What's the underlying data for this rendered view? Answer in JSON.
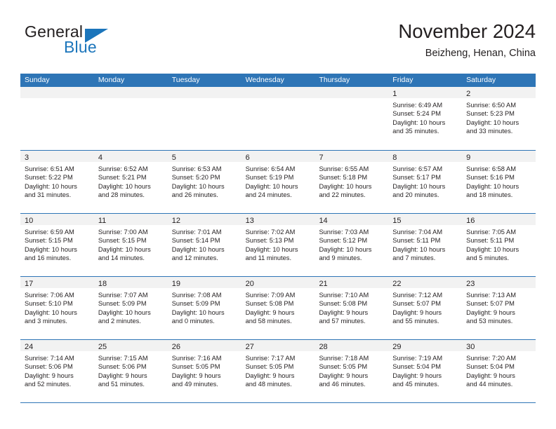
{
  "brand": {
    "name_part1": "General",
    "name_part2": "Blue",
    "accent_color": "#1b75bb"
  },
  "header": {
    "title": "November 2024",
    "location": "Beizheng, Henan, China"
  },
  "calendar": {
    "header_bg": "#2e75b6",
    "day_strip_bg": "#f2f2f2",
    "weekdays": [
      "Sunday",
      "Monday",
      "Tuesday",
      "Wednesday",
      "Thursday",
      "Friday",
      "Saturday"
    ],
    "weeks": [
      [
        {
          "day": "",
          "empty": true
        },
        {
          "day": "",
          "empty": true
        },
        {
          "day": "",
          "empty": true
        },
        {
          "day": "",
          "empty": true
        },
        {
          "day": "",
          "empty": true
        },
        {
          "day": "1",
          "sunrise": "Sunrise: 6:49 AM",
          "sunset": "Sunset: 5:24 PM",
          "daylight1": "Daylight: 10 hours",
          "daylight2": "and 35 minutes."
        },
        {
          "day": "2",
          "sunrise": "Sunrise: 6:50 AM",
          "sunset": "Sunset: 5:23 PM",
          "daylight1": "Daylight: 10 hours",
          "daylight2": "and 33 minutes."
        }
      ],
      [
        {
          "day": "3",
          "sunrise": "Sunrise: 6:51 AM",
          "sunset": "Sunset: 5:22 PM",
          "daylight1": "Daylight: 10 hours",
          "daylight2": "and 31 minutes."
        },
        {
          "day": "4",
          "sunrise": "Sunrise: 6:52 AM",
          "sunset": "Sunset: 5:21 PM",
          "daylight1": "Daylight: 10 hours",
          "daylight2": "and 28 minutes."
        },
        {
          "day": "5",
          "sunrise": "Sunrise: 6:53 AM",
          "sunset": "Sunset: 5:20 PM",
          "daylight1": "Daylight: 10 hours",
          "daylight2": "and 26 minutes."
        },
        {
          "day": "6",
          "sunrise": "Sunrise: 6:54 AM",
          "sunset": "Sunset: 5:19 PM",
          "daylight1": "Daylight: 10 hours",
          "daylight2": "and 24 minutes."
        },
        {
          "day": "7",
          "sunrise": "Sunrise: 6:55 AM",
          "sunset": "Sunset: 5:18 PM",
          "daylight1": "Daylight: 10 hours",
          "daylight2": "and 22 minutes."
        },
        {
          "day": "8",
          "sunrise": "Sunrise: 6:57 AM",
          "sunset": "Sunset: 5:17 PM",
          "daylight1": "Daylight: 10 hours",
          "daylight2": "and 20 minutes."
        },
        {
          "day": "9",
          "sunrise": "Sunrise: 6:58 AM",
          "sunset": "Sunset: 5:16 PM",
          "daylight1": "Daylight: 10 hours",
          "daylight2": "and 18 minutes."
        }
      ],
      [
        {
          "day": "10",
          "sunrise": "Sunrise: 6:59 AM",
          "sunset": "Sunset: 5:15 PM",
          "daylight1": "Daylight: 10 hours",
          "daylight2": "and 16 minutes."
        },
        {
          "day": "11",
          "sunrise": "Sunrise: 7:00 AM",
          "sunset": "Sunset: 5:15 PM",
          "daylight1": "Daylight: 10 hours",
          "daylight2": "and 14 minutes."
        },
        {
          "day": "12",
          "sunrise": "Sunrise: 7:01 AM",
          "sunset": "Sunset: 5:14 PM",
          "daylight1": "Daylight: 10 hours",
          "daylight2": "and 12 minutes."
        },
        {
          "day": "13",
          "sunrise": "Sunrise: 7:02 AM",
          "sunset": "Sunset: 5:13 PM",
          "daylight1": "Daylight: 10 hours",
          "daylight2": "and 11 minutes."
        },
        {
          "day": "14",
          "sunrise": "Sunrise: 7:03 AM",
          "sunset": "Sunset: 5:12 PM",
          "daylight1": "Daylight: 10 hours",
          "daylight2": "and 9 minutes."
        },
        {
          "day": "15",
          "sunrise": "Sunrise: 7:04 AM",
          "sunset": "Sunset: 5:11 PM",
          "daylight1": "Daylight: 10 hours",
          "daylight2": "and 7 minutes."
        },
        {
          "day": "16",
          "sunrise": "Sunrise: 7:05 AM",
          "sunset": "Sunset: 5:11 PM",
          "daylight1": "Daylight: 10 hours",
          "daylight2": "and 5 minutes."
        }
      ],
      [
        {
          "day": "17",
          "sunrise": "Sunrise: 7:06 AM",
          "sunset": "Sunset: 5:10 PM",
          "daylight1": "Daylight: 10 hours",
          "daylight2": "and 3 minutes."
        },
        {
          "day": "18",
          "sunrise": "Sunrise: 7:07 AM",
          "sunset": "Sunset: 5:09 PM",
          "daylight1": "Daylight: 10 hours",
          "daylight2": "and 2 minutes."
        },
        {
          "day": "19",
          "sunrise": "Sunrise: 7:08 AM",
          "sunset": "Sunset: 5:09 PM",
          "daylight1": "Daylight: 10 hours",
          "daylight2": "and 0 minutes."
        },
        {
          "day": "20",
          "sunrise": "Sunrise: 7:09 AM",
          "sunset": "Sunset: 5:08 PM",
          "daylight1": "Daylight: 9 hours",
          "daylight2": "and 58 minutes."
        },
        {
          "day": "21",
          "sunrise": "Sunrise: 7:10 AM",
          "sunset": "Sunset: 5:08 PM",
          "daylight1": "Daylight: 9 hours",
          "daylight2": "and 57 minutes."
        },
        {
          "day": "22",
          "sunrise": "Sunrise: 7:12 AM",
          "sunset": "Sunset: 5:07 PM",
          "daylight1": "Daylight: 9 hours",
          "daylight2": "and 55 minutes."
        },
        {
          "day": "23",
          "sunrise": "Sunrise: 7:13 AM",
          "sunset": "Sunset: 5:07 PM",
          "daylight1": "Daylight: 9 hours",
          "daylight2": "and 53 minutes."
        }
      ],
      [
        {
          "day": "24",
          "sunrise": "Sunrise: 7:14 AM",
          "sunset": "Sunset: 5:06 PM",
          "daylight1": "Daylight: 9 hours",
          "daylight2": "and 52 minutes."
        },
        {
          "day": "25",
          "sunrise": "Sunrise: 7:15 AM",
          "sunset": "Sunset: 5:06 PM",
          "daylight1": "Daylight: 9 hours",
          "daylight2": "and 51 minutes."
        },
        {
          "day": "26",
          "sunrise": "Sunrise: 7:16 AM",
          "sunset": "Sunset: 5:05 PM",
          "daylight1": "Daylight: 9 hours",
          "daylight2": "and 49 minutes."
        },
        {
          "day": "27",
          "sunrise": "Sunrise: 7:17 AM",
          "sunset": "Sunset: 5:05 PM",
          "daylight1": "Daylight: 9 hours",
          "daylight2": "and 48 minutes."
        },
        {
          "day": "28",
          "sunrise": "Sunrise: 7:18 AM",
          "sunset": "Sunset: 5:05 PM",
          "daylight1": "Daylight: 9 hours",
          "daylight2": "and 46 minutes."
        },
        {
          "day": "29",
          "sunrise": "Sunrise: 7:19 AM",
          "sunset": "Sunset: 5:04 PM",
          "daylight1": "Daylight: 9 hours",
          "daylight2": "and 45 minutes."
        },
        {
          "day": "30",
          "sunrise": "Sunrise: 7:20 AM",
          "sunset": "Sunset: 5:04 PM",
          "daylight1": "Daylight: 9 hours",
          "daylight2": "and 44 minutes."
        }
      ]
    ]
  }
}
